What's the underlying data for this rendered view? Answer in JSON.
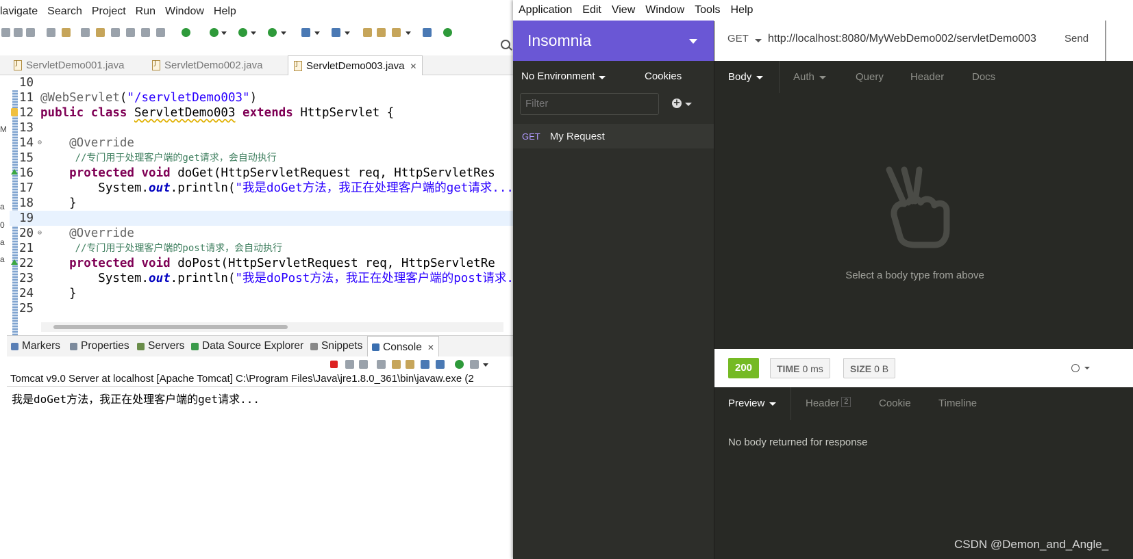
{
  "eclipse": {
    "menu": [
      "lavigate",
      "Search",
      "Project",
      "Run",
      "Window",
      "Help"
    ],
    "tabs": [
      {
        "label": "ServletDemo001.java",
        "active": false
      },
      {
        "label": "ServletDemo002.java",
        "active": false
      },
      {
        "label": "ServletDemo003.java",
        "active": true
      }
    ],
    "code_lines": [
      {
        "num": "10",
        "code": ""
      },
      {
        "num": "11",
        "code": "@WebServlet(\"/servletDemo003\")"
      },
      {
        "num": "12",
        "code": "public class ServletDemo003 extends HttpServlet {"
      },
      {
        "num": "13",
        "code": ""
      },
      {
        "num": "14",
        "code": "    @Override"
      },
      {
        "num": "15",
        "code": "    //专门用于处理客户端的get请求，会自动执行"
      },
      {
        "num": "16",
        "code": "    protected void doGet(HttpServletRequest req, HttpServletRes"
      },
      {
        "num": "17",
        "code": "        System.out.println(\"我是doGet方法，我正在处理客户端的get请求...\")"
      },
      {
        "num": "18",
        "code": "    }"
      },
      {
        "num": "19",
        "code": ""
      },
      {
        "num": "20",
        "code": "    @Override"
      },
      {
        "num": "21",
        "code": "    //专门用于处理客户端的post请求，会自动执行"
      },
      {
        "num": "22",
        "code": "    protected void doPost(HttpServletRequest req, HttpServletRe"
      },
      {
        "num": "23",
        "code": "        System.out.println(\"我是doPost方法，我正在处理客户端的post请求..."
      },
      {
        "num": "24",
        "code": "    }"
      },
      {
        "num": "25",
        "code": ""
      }
    ],
    "view_tabs": [
      {
        "label": "Markers",
        "icon": "markers-icon",
        "color": "#5a7fb5"
      },
      {
        "label": "Properties",
        "icon": "properties-icon",
        "color": "#7c8a9c"
      },
      {
        "label": "Servers",
        "icon": "servers-icon",
        "color": "#6a8d4a"
      },
      {
        "label": "Data Source Explorer",
        "icon": "data-source-icon",
        "color": "#3a9a4a"
      },
      {
        "label": "Snippets",
        "icon": "snippets-icon",
        "color": "#888888"
      },
      {
        "label": "Console",
        "icon": "console-icon",
        "color": "#3a6fb0",
        "active": true
      }
    ],
    "console_title": "Tomcat v9.0 Server at localhost [Apache Tomcat] C:\\Program Files\\Java\\jre1.8.0_361\\bin\\javaw.exe (2",
    "console_output": "我是doGet方法，我正在处理客户端的get请求..."
  },
  "insomnia": {
    "menu": [
      "Application",
      "Edit",
      "View",
      "Window",
      "Tools",
      "Help"
    ],
    "brand": "Insomnia",
    "environment": "No Environment",
    "cookies": "Cookies",
    "filter_placeholder": "Filter",
    "request": {
      "method": "GET",
      "name": "My Request"
    },
    "url_method": "GET",
    "url": "http://localhost:8080/MyWebDemo002/servletDemo003",
    "send": "Send",
    "request_tabs": [
      "Body",
      "Auth",
      "Query",
      "Header",
      "Docs"
    ],
    "body_hint": "Select a body type from above",
    "status": {
      "code": "200",
      "time_label": "TIME",
      "time": "0 ms",
      "size_label": "SIZE",
      "size": "0 B"
    },
    "response_tabs": {
      "preview": "Preview",
      "header": "Header",
      "header_count": "2",
      "cookie": "Cookie",
      "timeline": "Timeline"
    },
    "response_message": "No body returned for response",
    "colors": {
      "brand": "#6a57d5",
      "status_ok": "#75ba24",
      "background": "#282925"
    }
  },
  "watermark": "CSDN @Demon_and_Angle_"
}
